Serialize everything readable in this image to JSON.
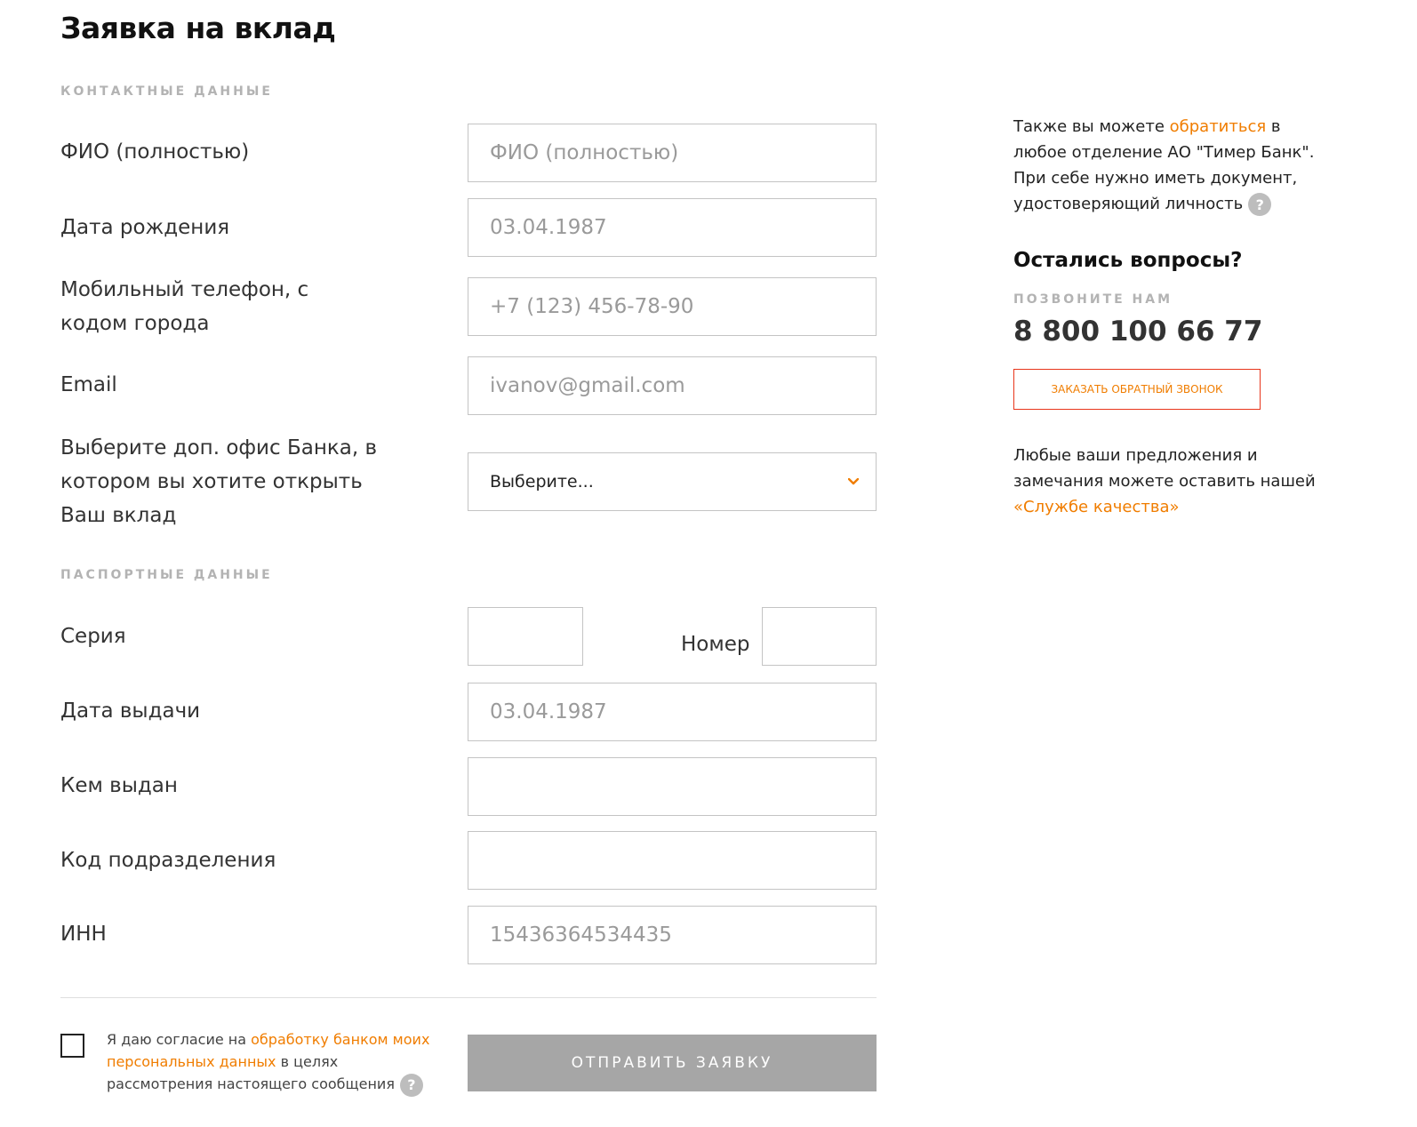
{
  "page": {
    "title": "Заявка на вклад"
  },
  "sections": {
    "contacts": "КОНТАКТНЫЕ ДАННЫЕ",
    "passport": "ПАСПОРТНЫЕ ДАННЫЕ"
  },
  "form": {
    "fio": {
      "label": "ФИО (полностью)",
      "placeholder": "ФИО (полностью)",
      "value": ""
    },
    "birthdate": {
      "label": "Дата рождения",
      "placeholder": "03.04.1987",
      "value": ""
    },
    "phone": {
      "label": "Мобильный телефон, с кодом города",
      "placeholder": "+7 (123) 456-78-90",
      "value": ""
    },
    "email": {
      "label": "Email",
      "placeholder": "ivanov@gmail.com",
      "value": ""
    },
    "office": {
      "label": "Выберите доп. офис Банка, в котором вы хотите открыть Ваш вклад",
      "selected": "Выберите..."
    },
    "series": {
      "label": "Серия",
      "value": ""
    },
    "number": {
      "label": "Номер",
      "value": ""
    },
    "issue_date": {
      "label": "Дата выдачи",
      "placeholder": "03.04.1987",
      "value": ""
    },
    "issued_by": {
      "label": "Кем выдан",
      "value": ""
    },
    "division_code": {
      "label": "Код подразделения",
      "value": ""
    },
    "inn": {
      "label": "ИНН",
      "placeholder": "15436364534435",
      "value": ""
    }
  },
  "consent": {
    "checked": false,
    "text_before": "Я даю согласие на ",
    "link": "обработку банком моих персональных данных",
    "text_after": " в целях рассмотрения настоящего сообщения",
    "help_icon": "question-icon"
  },
  "submit_label": "ОТПРАВИТЬ ЗАЯВКУ",
  "sidebar": {
    "info_before": "Также вы можете ",
    "info_link": "обратиться",
    "info_after": " в любое отделение АО \"Тимер Банк\". При себе нужно иметь документ, удостоверяющий личность",
    "questions_title": "Остались вопросы?",
    "call_us": "ПОЗВОНИТЕ НАМ",
    "phone": "8 800 100 66 77",
    "callback_label": "ЗАКАЗАТЬ ОБРАТНЫЙ ЗВОНОК",
    "feedback_before": "Любые ваши предложения и замечания можете оставить нашей ",
    "feedback_link": "«Службе качества»"
  },
  "colors": {
    "accent": "#f07d00",
    "button_disabled": "#a6a6a6",
    "muted": "#b3b3b3"
  }
}
